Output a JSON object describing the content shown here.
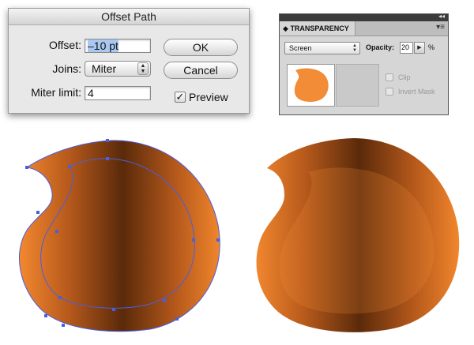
{
  "offset_dialog": {
    "title": "Offset Path",
    "offset_label": "Offset:",
    "offset_value": "–10 pt",
    "joins_label": "Joins:",
    "joins_value": "Miter",
    "miter_label": "Miter limit:",
    "miter_value": "4",
    "ok_label": "OK",
    "cancel_label": "Cancel",
    "preview_label": "Preview",
    "preview_checked": true
  },
  "transparency_panel": {
    "tab_label": "TRANSPARENCY",
    "blend_mode": "Screen",
    "opacity_label": "Opacity:",
    "opacity_value": "20",
    "opacity_unit": "%",
    "clip_label": "Clip",
    "invert_mask_label": "Invert Mask",
    "thumbnail_color": "#f28c36"
  },
  "colors": {
    "gradient_edge": "#f0852c",
    "gradient_center": "#5a2a0a",
    "path_selection": "#4a5ee0"
  }
}
